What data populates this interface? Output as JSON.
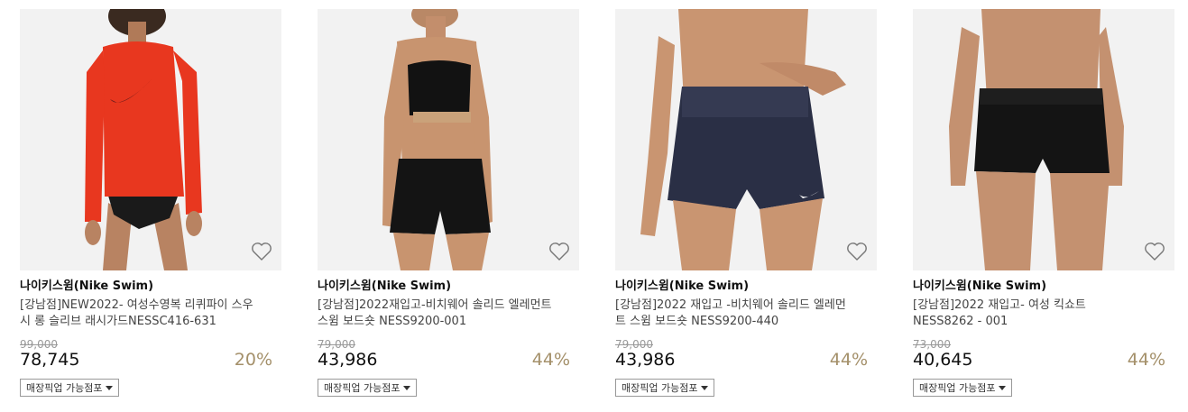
{
  "products": [
    {
      "brand": "나이키스윔(Nike Swim)",
      "name": "[강남점]NEW2022- 여성수영복 리퀴파이 스우시 롱 슬리브 래시가드NESSC416-631",
      "original_price": "99,000",
      "sale_price": "78,745",
      "discount": "20%",
      "pickup_label": "매장픽업 가능점포",
      "image": "model-red-rashguard"
    },
    {
      "brand": "나이키스윔(Nike Swim)",
      "name": "[강남점]2022재입고-비치웨어 솔리드 엘레먼트 스윔 보드숏 NESS9200-001",
      "original_price": "79,000",
      "sale_price": "43,986",
      "discount": "44%",
      "pickup_label": "매장픽업 가능점포",
      "image": "model-black-board-shorts"
    },
    {
      "brand": "나이키스윔(Nike Swim)",
      "name": "[강남점]2022 재입고 -비치웨어 솔리드 엘레먼트 스윔 보드숏 NESS9200-440",
      "original_price": "79,000",
      "sale_price": "43,986",
      "discount": "44%",
      "pickup_label": "매장픽업 가능점포",
      "image": "model-navy-board-shorts"
    },
    {
      "brand": "나이키스윔(Nike Swim)",
      "name": "[강남점]2022 재입고- 여성 킥쇼트 NESS8262 - 001",
      "original_price": "73,000",
      "sale_price": "40,645",
      "discount": "44%",
      "pickup_label": "매장픽업 가능점포",
      "image": "model-black-kick-shorts"
    }
  ],
  "colors": {
    "discount": "#a4906a",
    "thumb_bg": "#f2f2f2",
    "rashguard": "#e8371f",
    "navy": "#2a2f45",
    "black": "#151515",
    "skin": "#c08a68"
  },
  "icons": {
    "wishlist": "heart-outline-icon",
    "dropdown": "caret-down-icon"
  }
}
